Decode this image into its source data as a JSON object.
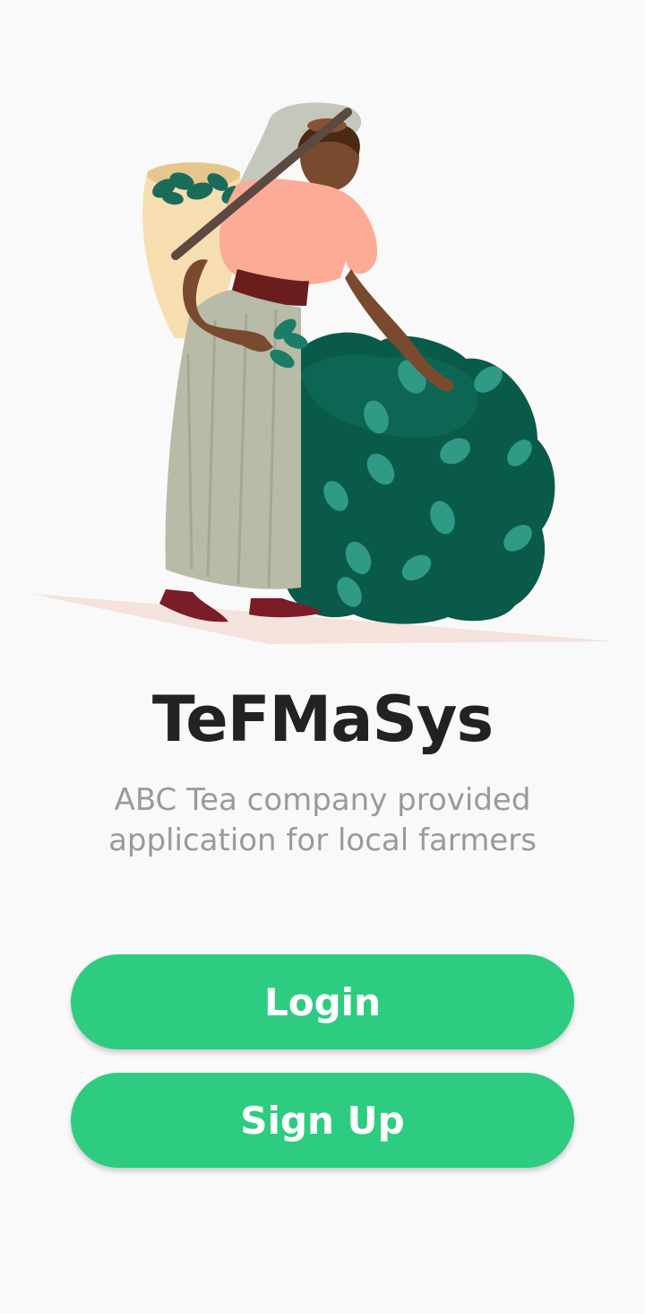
{
  "hero": {
    "illustration": "tea-picker-illustration"
  },
  "app": {
    "title": "TeFMaSys",
    "subtitle": "ABC Tea company provided application for local farmers"
  },
  "actions": {
    "login_label": "Login",
    "signup_label": "Sign Up"
  },
  "colors": {
    "background": "#f9f9f9",
    "button": "#2ecc80",
    "button_text": "#ffffff",
    "title": "#222222",
    "subtitle": "#9a9a9a"
  }
}
